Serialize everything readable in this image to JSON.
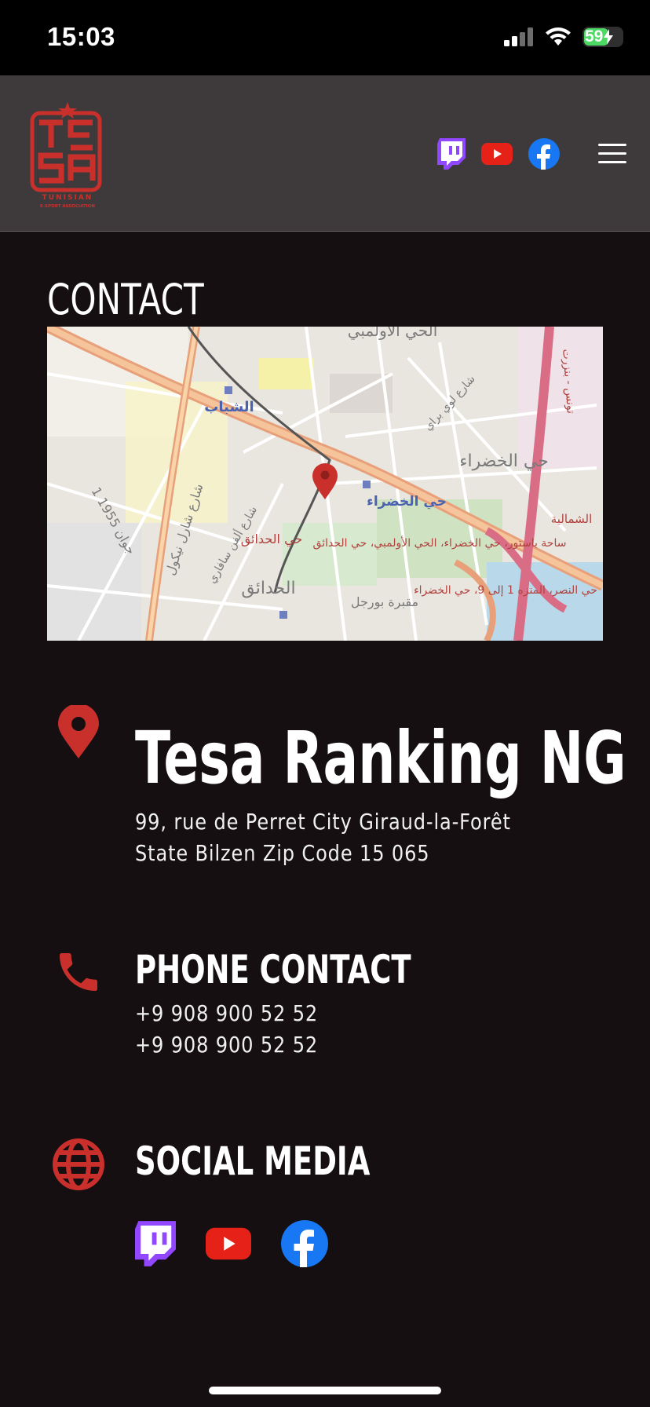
{
  "status": {
    "time": "15:03",
    "battery": "59"
  },
  "logo": {
    "letters": "TESA",
    "line1": "TUNISIAN",
    "line2": "E-SPORT ASSOCIATION"
  },
  "header": {
    "social": [
      "twitch-icon",
      "youtube-icon",
      "facebook-icon"
    ],
    "menu_icon": "hamburger-icon"
  },
  "page": {
    "title": "CONTACT"
  },
  "map": {
    "labels": [
      "الحي الأولمبي",
      "الشباب",
      "حي الخضراء",
      "حي الخضراء",
      "حي الحدائق",
      "الحدائق",
      "مقبرة بورجل",
      "1 جوان 1955",
      "شارع شارل نيكول",
      "شارع لوي براي",
      "ساحة باستور، حي الخضراء، الحي الأولمبي، حي الحدائق",
      "حي النصر، المنزه 1 إلى 9، حي الخضراء",
      "شارع ألفن سافاري",
      "الشمالية",
      "تونس - بنزرت"
    ]
  },
  "address": {
    "name": "Tesa Ranking NG",
    "line1": "99, rue de Perret City Giraud-la-Forêt",
    "line2": "State Bilzen Zip Code 15 065"
  },
  "phone": {
    "heading": "PHONE CONTACT",
    "number1": "+9 908 900 52 52",
    "number2": "+9 908 900 52 52"
  },
  "social": {
    "heading": "SOCIAL MEDIA",
    "icons": [
      "twitch-icon",
      "youtube-icon",
      "facebook-icon"
    ]
  },
  "colors": {
    "accent": "#c9302c",
    "background": "#150f12",
    "header": "#3e3a3c",
    "twitch": "#9146ff",
    "youtube": "#e62117",
    "facebook": "#1877f2"
  }
}
